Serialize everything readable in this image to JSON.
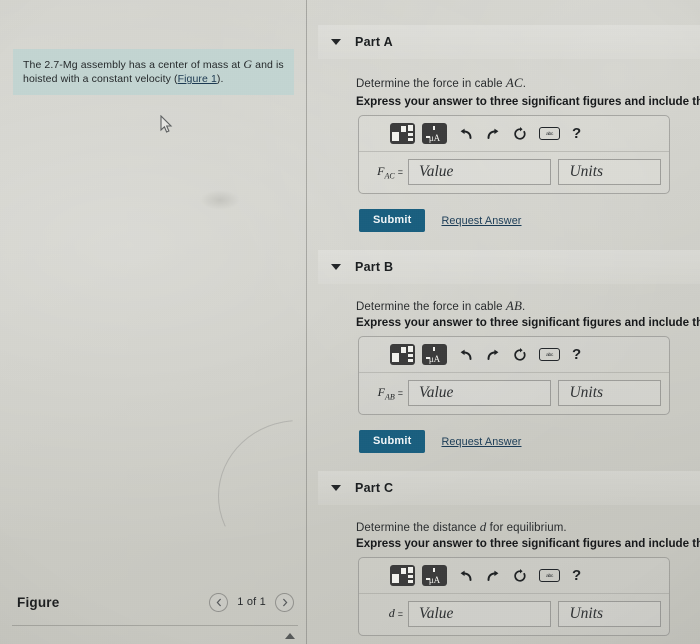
{
  "figure_panel": {
    "problem_text_pre": "The 2.7-Mg assembly has a center of mass at ",
    "problem_var": "G",
    "problem_text_mid": " and is hoisted with a constant velocity (",
    "figure_link": "Figure 1",
    "problem_text_post": ").",
    "footer": {
      "title": "Figure",
      "prev_icon": "chevron-left-icon",
      "count": "1 of 1",
      "next_icon": "chevron-right-icon",
      "collapse_icon": "triangle-up-icon"
    },
    "cursor_icon": "mouse-pointer-icon"
  },
  "toolbar": {
    "template_icon": "math-template-icon",
    "units_icon": "units-micro-amp-icon",
    "units_glyph": "μA",
    "undo_icon": "undo-arrow-icon",
    "undo_glyph": "↶",
    "redo_icon": "redo-arrow-icon",
    "redo_glyph": "↷",
    "reset_icon": "reset-circular-arrow-icon",
    "reset_glyph": "↻",
    "keyboard_icon": "keyboard-shortcuts-icon",
    "keyboard_glyph": "abc",
    "help_icon": "help-question-icon",
    "help_glyph": "?"
  },
  "common": {
    "instruction": "Express your answer to three significant figures and include the appropria",
    "submit_label": "Submit",
    "request_answer_label": "Request Answer",
    "value_placeholder": "Value",
    "units_placeholder": "Units",
    "equals": "=",
    "caret_icon": "caret-down-icon"
  },
  "parts": [
    {
      "id": "part-a",
      "label": "Part A",
      "prompt_pre": "Determine the force in cable ",
      "prompt_var": "AC",
      "prompt_post": ".",
      "var_base": "F",
      "var_sub": "AC"
    },
    {
      "id": "part-b",
      "label": "Part B",
      "prompt_pre": "Determine the force in cable ",
      "prompt_var": "AB",
      "prompt_post": ".",
      "var_base": "F",
      "var_sub": "AB"
    },
    {
      "id": "part-c",
      "label": "Part C",
      "prompt_pre": "Determine the distance ",
      "prompt_var": "d",
      "prompt_post": " for equilibrium.",
      "var_base": "d",
      "var_sub": ""
    }
  ],
  "colors": {
    "submit_bg": "#1a5f7f",
    "link": "#1b3c56",
    "statement_bg": "#bed5d2",
    "page_bg": "#cfcfc9"
  }
}
